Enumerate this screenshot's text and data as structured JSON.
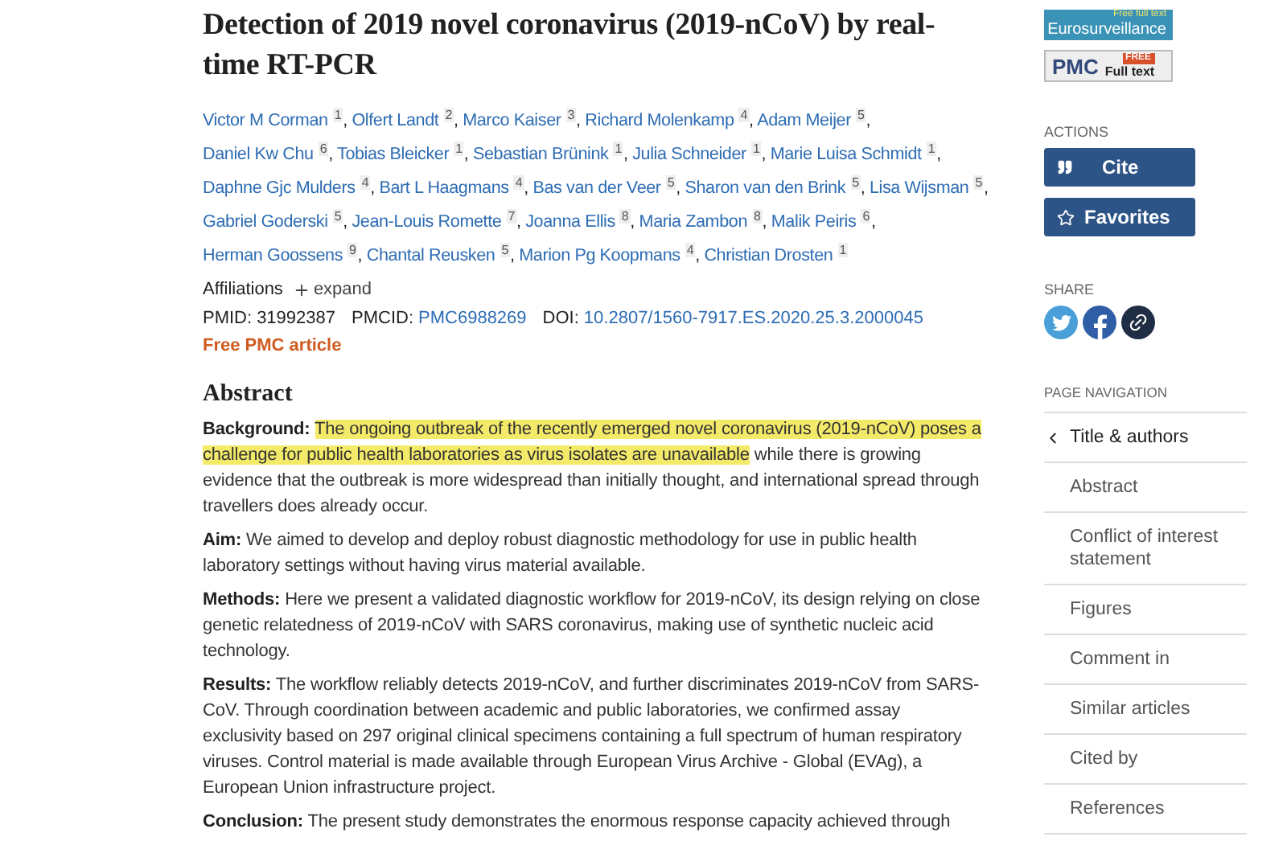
{
  "title": "Detection of 2019 novel coronavirus (2019-nCoV) by real-time RT-PCR",
  "authors": [
    {
      "name": "Victor M Corman",
      "affiliation": "1",
      "separator": ","
    },
    {
      "name": "Olfert Landt",
      "affiliation": "2",
      "separator": ","
    },
    {
      "name": "Marco Kaiser",
      "affiliation": "3",
      "separator": ","
    },
    {
      "name": "Richard Molenkamp",
      "affiliation": "4",
      "separator": ","
    },
    {
      "name": "Adam Meijer",
      "affiliation": "5",
      "separator": ","
    },
    {
      "name": "Daniel Kw Chu",
      "affiliation": "6",
      "separator": ","
    },
    {
      "name": "Tobias Bleicker",
      "affiliation": "1",
      "separator": ","
    },
    {
      "name": "Sebastian Brünink",
      "affiliation": "1",
      "separator": ","
    },
    {
      "name": "Julia Schneider",
      "affiliation": "1",
      "separator": ","
    },
    {
      "name": "Marie Luisa Schmidt",
      "affiliation": "1",
      "separator": ","
    },
    {
      "name": "Daphne Gjc Mulders",
      "affiliation": "4",
      "separator": ","
    },
    {
      "name": "Bart L Haagmans",
      "affiliation": "4",
      "separator": ","
    },
    {
      "name": "Bas van der Veer",
      "affiliation": "5",
      "separator": ","
    },
    {
      "name": "Sharon van den Brink",
      "affiliation": "5",
      "separator": ","
    },
    {
      "name": "Lisa Wijsman",
      "affiliation": "5",
      "separator": ","
    },
    {
      "name": "Gabriel Goderski",
      "affiliation": "5",
      "separator": ","
    },
    {
      "name": "Jean-Louis Romette",
      "affiliation": "7",
      "separator": ","
    },
    {
      "name": "Joanna Ellis",
      "affiliation": "8",
      "separator": ","
    },
    {
      "name": "Maria Zambon",
      "affiliation": "8",
      "separator": ","
    },
    {
      "name": "Malik Peiris",
      "affiliation": "6",
      "separator": ","
    },
    {
      "name": "Herman Goossens",
      "affiliation": "9",
      "separator": ","
    },
    {
      "name": "Chantal Reusken",
      "affiliation": "5",
      "separator": ","
    },
    {
      "name": "Marion Pg Koopmans",
      "affiliation": "4",
      "separator": ","
    },
    {
      "name": "Christian Drosten",
      "affiliation": "1"
    }
  ],
  "affiliations": {
    "label": "Affiliations",
    "toggle": "expand"
  },
  "ids": [
    {
      "label": "PMID:",
      "value": "31992387",
      "link": false
    },
    {
      "label": "PMCID:",
      "value": "PMC6988269",
      "link": true
    },
    {
      "label": "DOI:",
      "value": "10.2807/1560-7917.ES.2020.25.3.2000045",
      "link": true
    }
  ],
  "free_article": "Free PMC article",
  "abstract": {
    "heading": "Abstract",
    "sections": [
      {
        "label": "Background:",
        "highlighted": "The ongoing outbreak of the recently emerged novel coronavirus (2019-nCoV) poses a challenge for public health laboratories as virus isolates are unavailable",
        "text": " while there is growing evidence that the outbreak is more widespread than initially thought, and international spread through travellers does already occur."
      },
      {
        "label": "Aim:",
        "text": " We aimed to develop and deploy robust diagnostic methodology for use in public health laboratory settings without having virus material available."
      },
      {
        "label": "Methods:",
        "text": " Here we present a validated diagnostic workflow for 2019-nCoV, its design relying on close genetic relatedness of 2019-nCoV with SARS coronavirus, making use of synthetic nucleic acid technology."
      },
      {
        "label": "Results:",
        "text": " The workflow reliably detects 2019-nCoV, and further discriminates 2019-nCoV from SARS-CoV. Through coordination between academic and public laboratories, we confirmed assay exclusivity based on 297 original clinical specimens containing a full spectrum of human respiratory viruses. Control material is made available through European Virus Archive - Global (EVAg), a European Union infrastructure project."
      },
      {
        "label": "Conclusion:",
        "text": " The present study demonstrates the enormous response capacity achieved through"
      }
    ]
  },
  "sidebar": {
    "full_text_links": [
      {
        "kind": "eurosurveillance",
        "tag": "Free full text",
        "name": "Eurosurveillance"
      },
      {
        "kind": "pmc",
        "name": "PMC",
        "tag": "FREE",
        "caption": "Full text"
      }
    ],
    "actions_heading": "ACTIONS",
    "actions": [
      {
        "kind": "quote",
        "label": "Cite"
      },
      {
        "kind": "star",
        "label": "Favorites"
      }
    ],
    "share_heading": "SHARE",
    "share": [
      {
        "kind": "twitter"
      },
      {
        "kind": "facebook"
      },
      {
        "kind": "link"
      }
    ],
    "nav_heading": "PAGE NAVIGATION",
    "nav": [
      {
        "label": "Title & authors",
        "selected": true
      },
      {
        "label": "Abstract",
        "selected": false
      },
      {
        "label": "Conflict of interest statement",
        "selected": false
      },
      {
        "label": "Figures",
        "selected": false
      },
      {
        "label": "Comment in",
        "selected": false
      },
      {
        "label": "Similar articles",
        "selected": false
      },
      {
        "label": "Cited by",
        "selected": false
      },
      {
        "label": "References",
        "selected": false
      }
    ]
  }
}
